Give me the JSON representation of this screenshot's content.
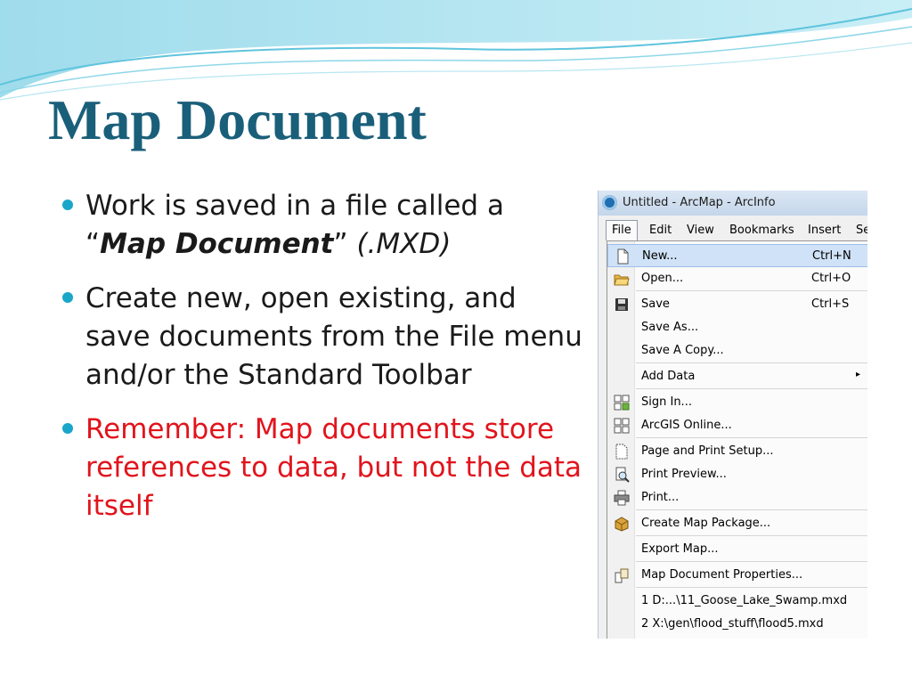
{
  "slide": {
    "title": "Map Document",
    "bullets": [
      {
        "text": "Work is saved in a file called a",
        "quote_open": "“",
        "doc_name": "Map Document",
        "quote_close": "”",
        "ext": "(.MXD)"
      },
      {
        "text": "Create new, open existing, and save documents from the File menu and/or the Standard Toolbar"
      },
      {
        "text": "Remember: Map documents store references to data, but not the data itself"
      }
    ],
    "colors": {
      "title": "#1a5f7a",
      "bullet": "#1aa6c9",
      "highlight_text": "#e1141c"
    }
  },
  "screenshot": {
    "window_title": "Untitled - ArcMap - ArcInfo",
    "menubar": [
      "File",
      "Edit",
      "View",
      "Bookmarks",
      "Insert",
      "Se"
    ],
    "file_menu": [
      {
        "label": "New...",
        "shortcut": "Ctrl+N",
        "icon": "new-document-icon",
        "highlighted": true
      },
      {
        "label": "Open...",
        "shortcut": "Ctrl+O",
        "icon": "open-folder-icon"
      },
      {
        "label": "Save",
        "shortcut": "Ctrl+S",
        "icon": "save-disk-icon"
      },
      {
        "label": "Save As...",
        "shortcut": "",
        "icon": ""
      },
      {
        "label": "Save A Copy...",
        "shortcut": "",
        "icon": ""
      },
      {
        "label": "Add Data",
        "shortcut": "",
        "icon": "",
        "submenu_arrow": "▸"
      },
      {
        "label": "Sign In...",
        "shortcut": "",
        "icon": "sign-in-icon"
      },
      {
        "label": "ArcGIS Online...",
        "shortcut": "",
        "icon": "arcgis-online-icon"
      },
      {
        "label": "Page and Print Setup...",
        "shortcut": "",
        "icon": "page-setup-icon"
      },
      {
        "label": "Print Preview...",
        "shortcut": "",
        "icon": "print-preview-icon"
      },
      {
        "label": "Print...",
        "shortcut": "",
        "icon": "printer-icon"
      },
      {
        "label": "Create Map Package...",
        "shortcut": "",
        "icon": "map-package-icon"
      },
      {
        "label": "Export Map...",
        "shortcut": "",
        "icon": ""
      },
      {
        "label": "Map Document Properties...",
        "shortcut": "",
        "icon": "document-properties-icon"
      },
      {
        "label": "1 D:...\\11_Goose_Lake_Swamp.mxd",
        "shortcut": "",
        "icon": ""
      },
      {
        "label": "2 X:\\gen\\flood_stuff\\flood5.mxd",
        "shortcut": "",
        "icon": ""
      }
    ]
  }
}
